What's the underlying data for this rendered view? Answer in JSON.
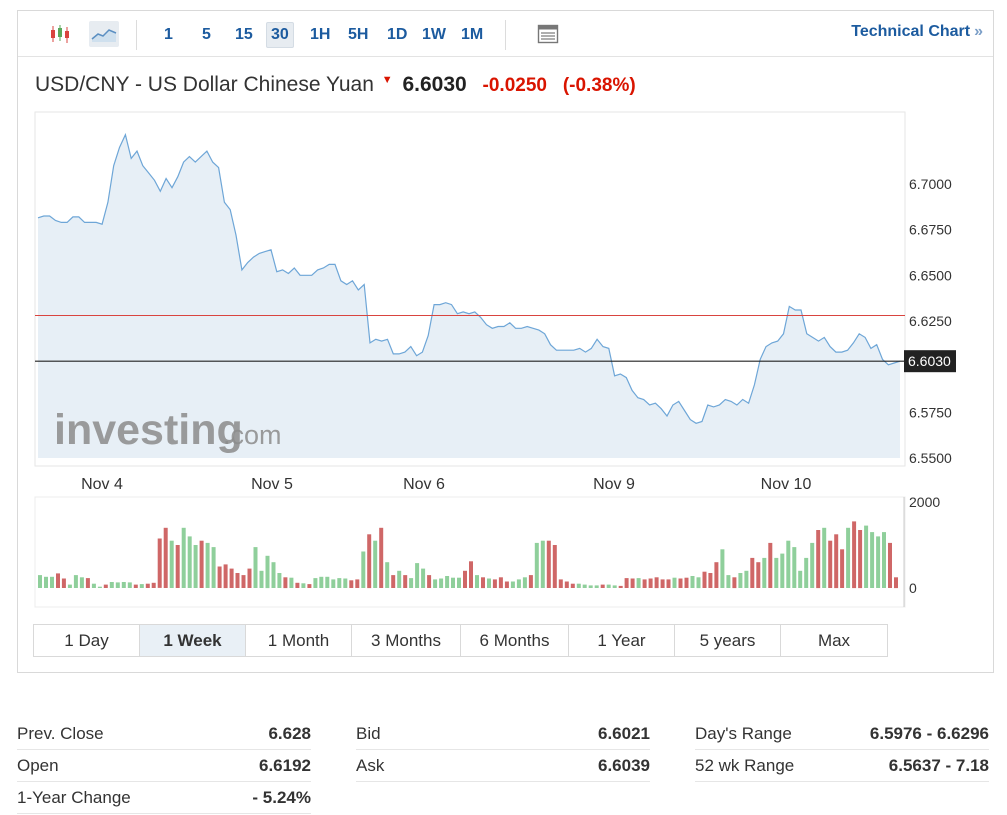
{
  "toolbar": {
    "icons": [
      "candlestick-icon",
      "line-chart-icon"
    ],
    "intervals": [
      "1",
      "5",
      "15",
      "30",
      "1H",
      "5H",
      "1D",
      "1W",
      "1M"
    ],
    "selected_interval": "30",
    "technical_chart_label": "Technical Chart",
    "technical_chart_arrow": "»"
  },
  "header": {
    "name": "USD/CNY - US Dollar Chinese Yuan",
    "arrow": "▼",
    "price": "6.6030",
    "change": "-0.0250",
    "change_pct": "(-0.38%)"
  },
  "colors": {
    "line": "#6ea6d7",
    "area": "#e7eff6",
    "prev_close_line": "#d9443f",
    "current_line": "#222222",
    "up_volume": "#8fcf9b",
    "down_volume": "#cf6767",
    "link": "#1c5b9f",
    "down_text": "#d91400"
  },
  "watermark": "investing.com",
  "chart_data": {
    "type": "line",
    "title": "USD/CNY - US Dollar Chinese Yuan",
    "x_labels": [
      "Nov 4",
      "Nov 5",
      "Nov 6",
      "Nov 9",
      "Nov 10"
    ],
    "y_ticks": [
      "6.7000",
      "6.6750",
      "6.6500",
      "6.6250",
      "6.5750",
      "6.5500"
    ],
    "ylim": [
      6.55,
      6.72
    ],
    "current_price": 6.603,
    "current_price_label": "6.6030",
    "prev_close": 6.628,
    "series": [
      {
        "values": [
          6.6815,
          6.6825,
          6.6825,
          6.68,
          6.679,
          6.679,
          6.682,
          6.682,
          6.679,
          6.679,
          6.679,
          6.678,
          6.69,
          6.71,
          6.72,
          6.727,
          6.714,
          6.718,
          6.71,
          6.706,
          6.702,
          6.696,
          6.703,
          6.698,
          6.704,
          6.712,
          6.715,
          6.712,
          6.715,
          6.718,
          6.712,
          6.709,
          6.69,
          6.686,
          6.672,
          6.653,
          6.657,
          6.66,
          6.662,
          6.663,
          6.664,
          6.652,
          6.653,
          6.651,
          6.654,
          6.65,
          6.65,
          6.65,
          6.653,
          6.654,
          6.656,
          6.656,
          6.647,
          6.645,
          6.647,
          6.642,
          6.645,
          6.613,
          6.615,
          6.614,
          6.615,
          6.607,
          6.607,
          6.608,
          6.611,
          6.606,
          6.608,
          6.617,
          6.634,
          6.634,
          6.635,
          6.634,
          6.629,
          6.63,
          6.629,
          6.63,
          6.627,
          6.623,
          6.621,
          6.622,
          6.622,
          6.624,
          6.621,
          6.621,
          6.622,
          6.621,
          6.62,
          6.618,
          6.612,
          6.609,
          6.609,
          6.609,
          6.609,
          6.61,
          6.608,
          6.61,
          6.615,
          6.611,
          6.61,
          6.595,
          6.596,
          6.594,
          6.587,
          6.583,
          6.582,
          6.579,
          6.58,
          6.577,
          6.573,
          6.579,
          6.581,
          6.576,
          6.571,
          6.569,
          6.57,
          6.579,
          6.578,
          6.579,
          6.582,
          6.581,
          6.579,
          6.582,
          6.58,
          6.59,
          6.604,
          6.611,
          6.613,
          6.614,
          6.618,
          6.633,
          6.631,
          6.631,
          6.618,
          6.616,
          6.614,
          6.616,
          6.611,
          6.608,
          6.608,
          6.609,
          6.613,
          6.618,
          6.616,
          6.61,
          6.612,
          6.604,
          6.601,
          6.602,
          6.603
        ]
      }
    ],
    "volume": {
      "ylim": [
        0,
        2000
      ],
      "y_ticks": [
        "2000",
        "0"
      ],
      "values": [
        300,
        260,
        260,
        340,
        220,
        80,
        300,
        250,
        230,
        100,
        30,
        80,
        140,
        130,
        140,
        130,
        80,
        90,
        100,
        120,
        1150,
        1400,
        1100,
        1000,
        1400,
        1200,
        1000,
        1100,
        1050,
        950,
        500,
        550,
        450,
        350,
        300,
        450,
        950,
        400,
        750,
        600,
        350,
        250,
        240,
        120,
        110,
        90,
        230,
        260,
        260,
        200,
        230,
        220,
        180,
        200,
        850,
        1250,
        1100,
        1400,
        600,
        300,
        400,
        300,
        230,
        580,
        450,
        300,
        200,
        220,
        280,
        240,
        240,
        400,
        620,
        300,
        250,
        220,
        200,
        250,
        150,
        150,
        200,
        250,
        300,
        1050,
        1100,
        1100,
        1000,
        200,
        150,
        100,
        100,
        80,
        60,
        60,
        80,
        80,
        60,
        50,
        230,
        220,
        230,
        200,
        220,
        250,
        200,
        200,
        240,
        220,
        240,
        280,
        250,
        380,
        350,
        600,
        900,
        300,
        250,
        350,
        400,
        700,
        600,
        700,
        1050,
        700,
        800,
        1100,
        950,
        400,
        700,
        1050,
        1350,
        1400,
        1100,
        1250,
        900,
        1400,
        1550,
        1350,
        1450,
        1300,
        1200,
        1300,
        1050,
        250
      ]
    }
  },
  "time_ranges": {
    "items": [
      "1 Day",
      "1 Week",
      "1 Month",
      "3 Months",
      "6 Months",
      "1 Year",
      "5 years",
      "Max"
    ],
    "selected": "1 Week"
  },
  "stats": {
    "col1": [
      {
        "label": "Prev. Close",
        "value": "6.628"
      },
      {
        "label": "Open",
        "value": "6.6192"
      },
      {
        "label": "1-Year Change",
        "value": "- 5.24%"
      }
    ],
    "col2": [
      {
        "label": "Bid",
        "value": "6.6021"
      },
      {
        "label": "Ask",
        "value": "6.6039"
      }
    ],
    "col3": [
      {
        "label": "Day's Range",
        "value": "6.5976 - 6.6296"
      },
      {
        "label": "52 wk Range",
        "value": "6.5637 - 7.18"
      }
    ]
  }
}
